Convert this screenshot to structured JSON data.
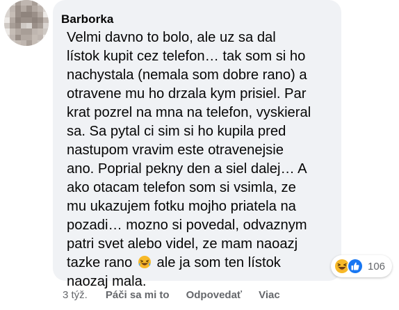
{
  "comment": {
    "author": "Barborka",
    "lines": [
      "Velmi davno to bolo, ale uz sa dal",
      "lístok kupit cez telefon… tak som si ho",
      "nachystala (nemala som dobre rano) a",
      "otravene mu ho drzala kym prisiel. Par",
      "krat pozrel na mna na telefon, vyskieral",
      "sa. Sa pytal ci sim si ho kupila pred",
      "nastupom vravim este otravenejsie",
      "ano. Poprial pekny den a siel dalej… A",
      "ako otacam telefon som si vsimla, ze",
      "mu ukazujem fotku mojho priatela na",
      "pozadi… mozno si povedal, odvaznym",
      "patri svet alebo videl, ze mam naoazj"
    ],
    "line_before_emoji": "tazke rano",
    "line_after_emoji": "ale ja som ten lístok",
    "last_line": "naozaj mala.",
    "inline_emoji": "laughing-tears-emoji"
  },
  "reactions": {
    "icons": [
      "haha-icon",
      "like-icon"
    ],
    "count": "106"
  },
  "actions": {
    "time": "3 týž.",
    "like_label": "Páči sa mi to",
    "reply_label": "Odpovedať",
    "more_label": "Viac"
  },
  "colors": {
    "bubble": "#f0f2f5",
    "text": "#050505",
    "secondary": "#65676b",
    "like_blue": "#1877f2",
    "haha_yellow": "#f7b928"
  }
}
